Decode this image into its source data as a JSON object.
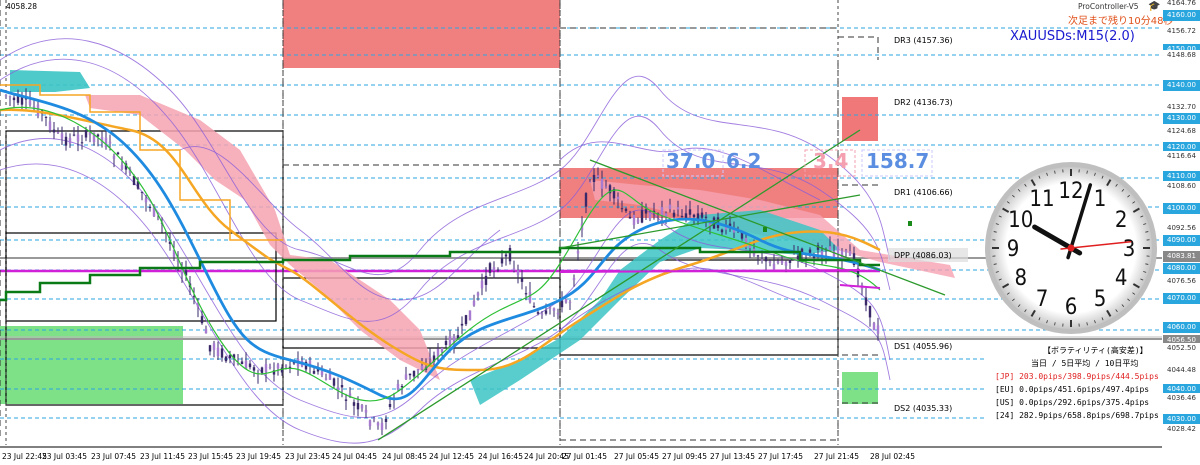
{
  "header": {
    "top_left_price": "4058.28",
    "brand": "ProController-V5",
    "countdown": "次足まで残り10分48秒",
    "symbol": "XAUUSDs:M15(2.0)"
  },
  "price_axis": [
    {
      "label": "4164.76",
      "style": "plain"
    },
    {
      "label": "4160.00",
      "style": "blue"
    },
    {
      "label": "4156.72",
      "style": "plain"
    },
    {
      "label": "4150.00",
      "style": "blue"
    },
    {
      "label": "4148.68",
      "style": "plain"
    },
    {
      "label": "4140.00",
      "style": "blue"
    },
    {
      "label": "4132.70",
      "style": "plain"
    },
    {
      "label": "4130.00",
      "style": "blue"
    },
    {
      "label": "4124.68",
      "style": "plain"
    },
    {
      "label": "4120.00",
      "style": "blue"
    },
    {
      "label": "4116.64",
      "style": "plain"
    },
    {
      "label": "4110.00",
      "style": "blue"
    },
    {
      "label": "4108.60",
      "style": "plain"
    },
    {
      "label": "4100.00",
      "style": "blue"
    },
    {
      "label": "4092.56",
      "style": "plain"
    },
    {
      "label": "4090.00",
      "style": "blue"
    },
    {
      "label": "4083.81",
      "style": "gray"
    },
    {
      "label": "4080.00",
      "style": "blue"
    },
    {
      "label": "4076.56",
      "style": "plain"
    },
    {
      "label": "4070.00",
      "style": "blue"
    },
    {
      "label": "4060.00",
      "style": "blue"
    },
    {
      "label": "4056.50",
      "style": "gray"
    },
    {
      "label": "4050.00",
      "style": "blue"
    },
    {
      "label": "4052.50",
      "style": "plain"
    },
    {
      "label": "4044.48",
      "style": "plain"
    },
    {
      "label": "4040.00",
      "style": "blue"
    },
    {
      "label": "4036.46",
      "style": "plain"
    },
    {
      "label": "4030.00",
      "style": "blue"
    },
    {
      "label": "4028.42",
      "style": "plain"
    }
  ],
  "pivots": [
    {
      "label": "DR3 (4157.36)"
    },
    {
      "label": "DR2 (4136.73)"
    },
    {
      "label": "DR1 (4106.66)"
    },
    {
      "label": "DPP (4086.03)"
    },
    {
      "label": "DS1 (4055.96)"
    },
    {
      "label": "DS2 (4035.33)"
    }
  ],
  "stats": [
    {
      "value": "37.0",
      "color": "#5b8ee0"
    },
    {
      "value": "6.2",
      "color": "#5b8ee0"
    },
    {
      "value": "3.4",
      "color": "#f4a0b0"
    },
    {
      "value": "158.7",
      "color": "#5b8ee0"
    }
  ],
  "time_axis": [
    "23 Jul 2025",
    "23 Jul 22:45",
    "23 Jul 03:45",
    "23 Jul 07:45",
    "23 Jul 11:45",
    "23 Jul 15:45",
    "23 Jul 19:45",
    "23 Jul 23:45",
    "24 Jul 04:45",
    "24 Jul 08:45",
    "24 Jul 12:45",
    "24 Jul 16:45",
    "24 Jul 20:45",
    "27 Jul 01:45",
    "27 Jul 05:45",
    "27 Jul 09:45",
    "27 Jul 13:45",
    "27 Jul 17:45",
    "27 Jul 21:45",
    "28 Jul 02:45"
  ],
  "volatility": {
    "title": "【ボラティリティ(高安差)】",
    "subtitle": "当日 / 5日平均 / 10日平均",
    "rows": [
      {
        "label": "[JP] 203.0pips/398.9pips/444.5pips",
        "color": "#e02020"
      },
      {
        "label": "[EU]   0.0pips/451.6pips/497.4pips",
        "color": "#000000"
      },
      {
        "label": "[US]   0.0pips/292.6pips/375.4pips",
        "color": "#000000"
      },
      {
        "label": "[24] 282.9pips/658.8pips/698.7pips",
        "color": "#000000"
      }
    ]
  },
  "clock": {
    "hour_numbers": [
      "12",
      "1",
      "2",
      "3",
      "4",
      "5",
      "6",
      "7",
      "8",
      "9",
      "10",
      "11"
    ]
  },
  "colors": {
    "accent_blue": "#2aa6df",
    "ma_orange": "#f5a623",
    "ma_green": "#0a7a16",
    "magenta": "#d020d8",
    "cloud_pink": "#f6a3b2",
    "cloud_teal": "#3cc4c4"
  }
}
